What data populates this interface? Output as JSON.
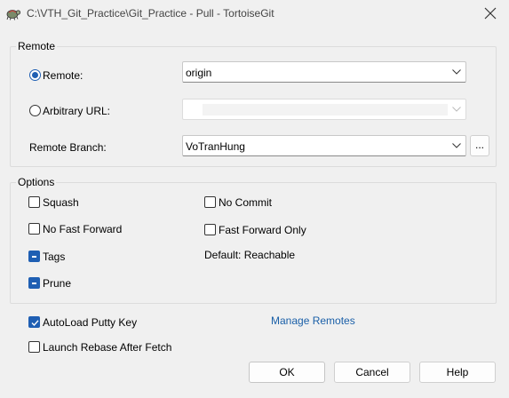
{
  "window": {
    "title": "C:\\VTH_Git_Practice\\Git_Practice - Pull - TortoiseGit"
  },
  "remote_group": {
    "label": "Remote",
    "remote_radio_label": "Remote:",
    "remote_selected": true,
    "remote_value": "origin",
    "arbitrary_url_label": "Arbitrary URL:",
    "arbitrary_url_selected": false,
    "arbitrary_url_value": "",
    "remote_branch_label": "Remote Branch:",
    "remote_branch_value": "VoTranHung",
    "browse_label": "..."
  },
  "options_group": {
    "label": "Options",
    "squash_label": "Squash",
    "squash_checked": false,
    "no_commit_label": "No Commit",
    "no_commit_checked": false,
    "no_fast_forward_label": "No Fast Forward",
    "no_fast_forward_checked": false,
    "fast_forward_only_label": "Fast Forward Only",
    "fast_forward_only_checked": false,
    "tags_label": "Tags",
    "tags_state": "indeterminate",
    "default_reachable_label": "Default: Reachable",
    "prune_label": "Prune",
    "prune_state": "indeterminate"
  },
  "bottom": {
    "autoload_putty_label": "AutoLoad Putty Key",
    "autoload_putty_checked": true,
    "manage_remotes_label": "Manage Remotes",
    "launch_rebase_label": "Launch Rebase After Fetch",
    "launch_rebase_checked": false
  },
  "buttons": {
    "ok": "OK",
    "cancel": "Cancel",
    "help": "Help"
  },
  "colors": {
    "accent": "#1f5fb3",
    "link": "#1a5fa8",
    "background": "#f0f0f0"
  }
}
